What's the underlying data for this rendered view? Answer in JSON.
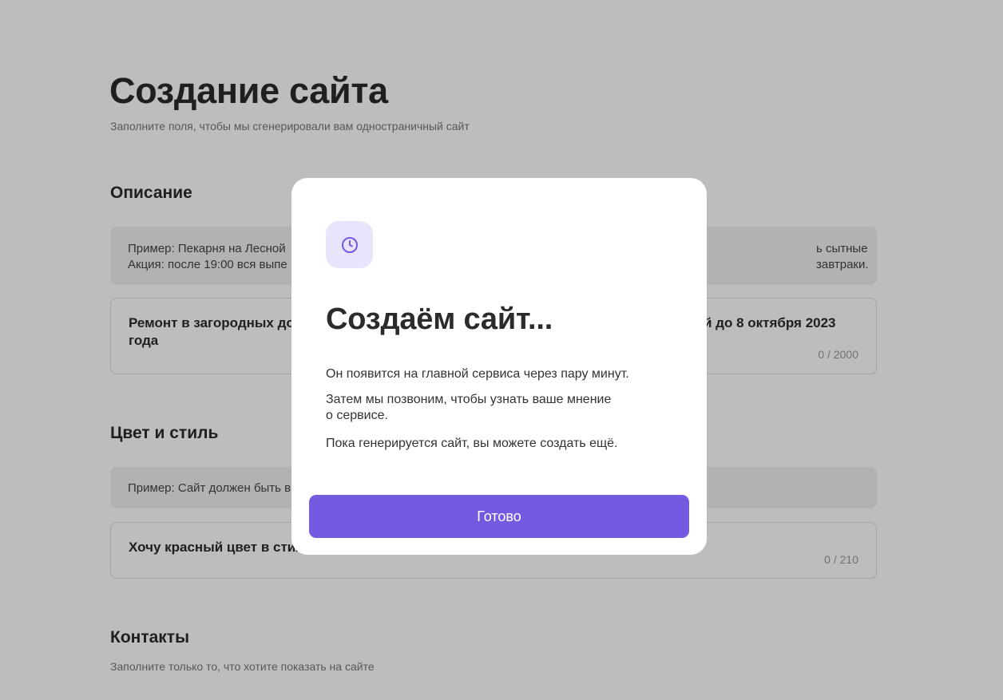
{
  "page": {
    "title": "Создание сайта",
    "subtitle": "Заполните поля, чтобы мы сгенерировали вам одностраничный сайт"
  },
  "description": {
    "title": "Описание",
    "example_line1_left": "Пример: Пекарня на Лесной",
    "example_line1_right": "ь сытные завтраки.",
    "example_line2_left": "Акция: после 19:00 вся выпе",
    "value_line1_left": "Ремонт в загородных дом",
    "value_line1_right": "й до 8 октября 2023",
    "value_line2_left": "года",
    "counter": "0 / 2000"
  },
  "style": {
    "title": "Цвет и стиль",
    "example_left": "Пример: Сайт должен быть в",
    "value_left": "Хочу красный цвет в стил",
    "counter": "0 / 210"
  },
  "contacts": {
    "title": "Контакты",
    "subtitle": "Заполните только то, что хотите показать на сайте"
  },
  "modal": {
    "icon": "clock-icon",
    "title": "Создаём сайт...",
    "paragraph1": "Он появится на главной сервиса через пару минут.",
    "paragraph2_line1": "Затем мы позвоним, чтобы узнать ваше мнение",
    "paragraph2_line2": "о сервисе.",
    "paragraph3": "Пока генерируется сайт, вы можете создать ещё.",
    "button_label": "Готово"
  },
  "colors": {
    "accent": "#7559e1",
    "icon_bg": "#e7e4fb",
    "overlay": "rgba(0,0,0,0.26)"
  }
}
